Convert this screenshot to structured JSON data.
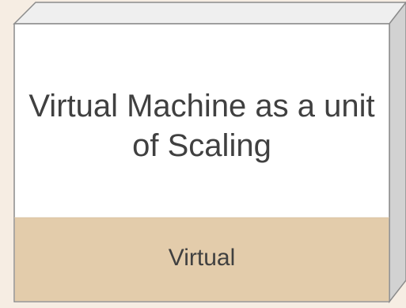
{
  "diagram": {
    "main_label": "Virtual Machine as a unit of Scaling",
    "band_label": "Virtual",
    "colors": {
      "background": "#f6ede3",
      "front_face": "#ffffff",
      "top_face": "#efefef",
      "side_face": "#d2d2d2",
      "band_fill": "#e3ccab",
      "outline": "#8c8c8c",
      "text": "#404040"
    }
  }
}
